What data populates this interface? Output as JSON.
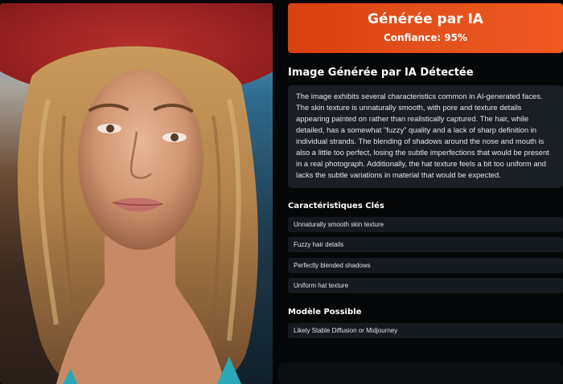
{
  "verdict": {
    "title": "Générée par IA",
    "confidence": "Confiance: 95%",
    "color": "#e4501a"
  },
  "analysis": {
    "heading": "Image Générée par IA Détectée",
    "description": "The image exhibits several characteristics common in AI-generated faces. The skin texture is unnaturally smooth, with pore and texture details appearing painted on rather than realistically captured. The hair, while detailed, has a somewhat \"fuzzy\" quality and a lack of sharp definition in individual strands. The blending of shadows around the nose and mouth is also a little too perfect, losing the subtle imperfections that would be present in a real photograph. Additionally, the hat texture feels a bit too uniform and lacks the subtle variations in material that would be expected."
  },
  "key_features": {
    "heading": "Caractéristiques Clés",
    "items": [
      "Unnaturally smooth skin texture",
      "Fuzzy hair details",
      "Perfectly blended shadows",
      "Uniform hat texture"
    ]
  },
  "possible_model": {
    "heading": "Modèle Possible",
    "value": "Likely Stable Diffusion or Midjourney"
  }
}
